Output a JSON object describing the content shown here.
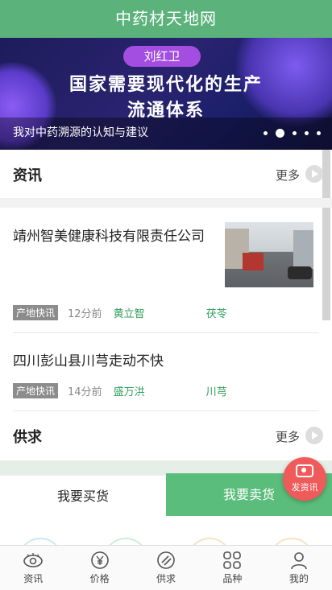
{
  "app": {
    "title": "中药材天地网"
  },
  "banner": {
    "author_pill": "刘红卫",
    "headline_line1": "国家需要现代化的生产",
    "headline_line2": "流通体系",
    "caption": "我对中药溯源的认知与建议",
    "slide_count": 5,
    "active_slide": 2
  },
  "news_section": {
    "title": "资讯",
    "more_label": "更多",
    "items": [
      {
        "headline": "靖州智美健康科技有限责任公司",
        "tag": "产地快讯",
        "time": "12分前",
        "author": "黄立智",
        "crop": "茯苓"
      },
      {
        "headline": "四川彭山县川芎走动不快",
        "tag": "产地快讯",
        "time": "14分前",
        "author": "盛万洪",
        "crop": "川芎"
      }
    ]
  },
  "supply_section": {
    "title": "供求",
    "more_label": "更多"
  },
  "actions": {
    "buy_label": "我要买货",
    "sell_label": "我要卖货",
    "post_news_label": "发资讯"
  },
  "tabbar": {
    "items": [
      {
        "label": "资讯",
        "icon": "eye-icon"
      },
      {
        "label": "价格",
        "icon": "yen-icon"
      },
      {
        "label": "供求",
        "icon": "slash-circle-icon"
      },
      {
        "label": "品种",
        "icon": "grid-icon"
      },
      {
        "label": "我的",
        "icon": "user-icon"
      }
    ]
  },
  "colors": {
    "brand_green": "#5bb27a",
    "accent_green": "#2f9e5a",
    "fab_red": "#ef5a5a"
  }
}
